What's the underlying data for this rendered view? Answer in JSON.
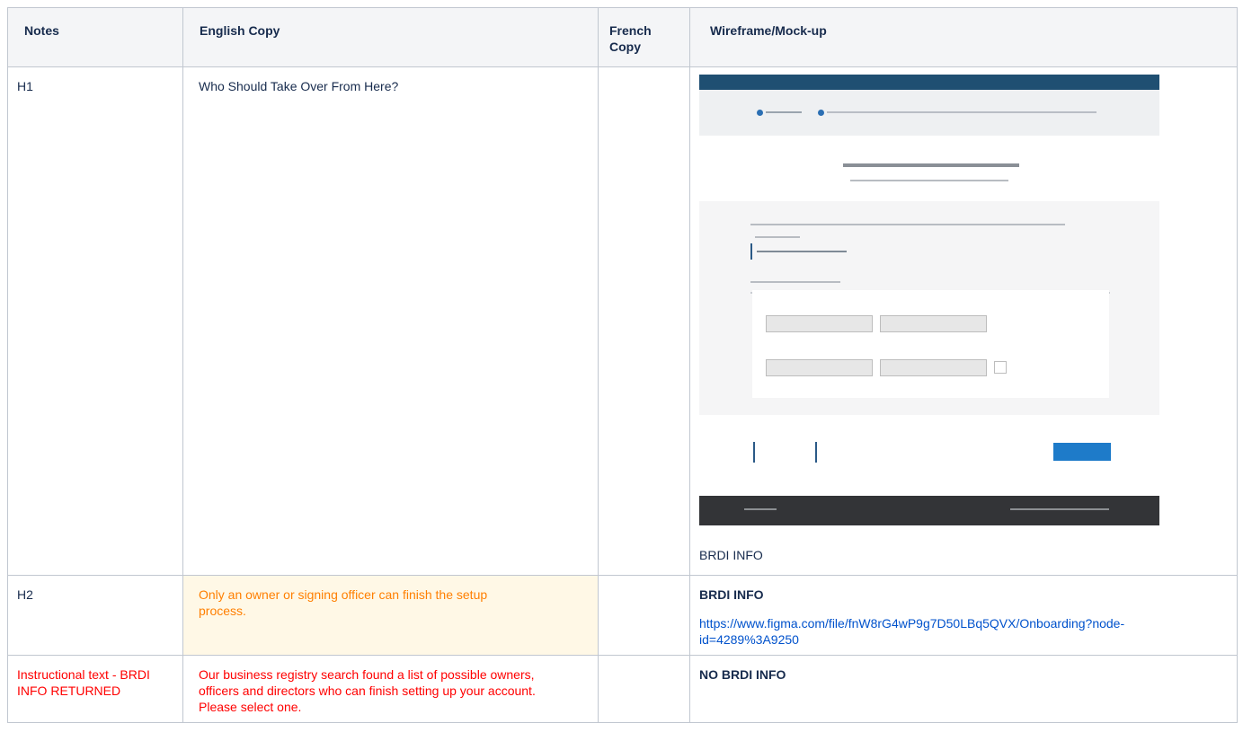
{
  "headers": {
    "notes": "Notes",
    "english": "English Copy",
    "french": "French Copy",
    "wireframe": "Wireframe/Mock-up"
  },
  "rows": [
    {
      "notes": "H1",
      "english": "Who Should Take Over From Here?",
      "french": "",
      "mock_caption": "BRDI INFO"
    },
    {
      "notes": "H2",
      "english": "Only an owner or signing officer can finish the setup process.",
      "french": "",
      "wire_title": "BRDI INFO",
      "wire_link": "https://www.figma.com/file/fnW8rG4wP9g7D50LBq5QVX/Onboarding?node-id=4289%3A9250"
    },
    {
      "notes": "Instructional text - BRDI INFO RETURNED",
      "english": "Our business registry search found a list of possible owners, officers and directors who can finish setting up your account. Please select one.",
      "french": "",
      "wire_title": "NO BRDI INFO"
    }
  ],
  "colors": {
    "highlight_text": "#ff7f00",
    "highlight_bg": "#fff8e6",
    "instruction_text": "#ff0000",
    "link": "#0052cc",
    "mock_header": "#1f4f72",
    "mock_button": "#1e7bc9"
  }
}
